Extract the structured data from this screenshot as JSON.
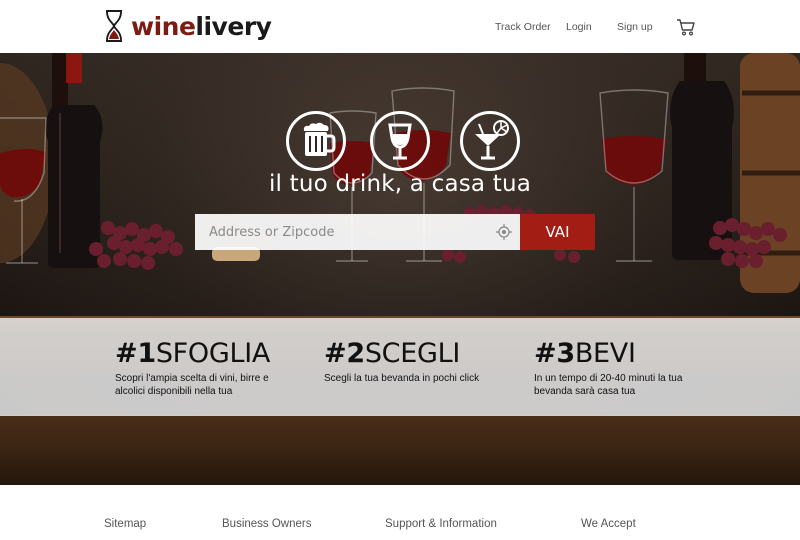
{
  "brand": {
    "name_part1": "wine",
    "name_part2": "livery",
    "accent": "#7d1a14"
  },
  "nav": {
    "track_order": "Track Order",
    "login": "Login",
    "sign_up": "Sign up",
    "cart_icon": "cart-icon"
  },
  "hero": {
    "icons": [
      "beer-mug-icon",
      "wine-glass-icon",
      "cocktail-icon"
    ],
    "tagline": "il tuo drink, a casa tua",
    "search": {
      "placeholder": "Address or Zipcode",
      "value": "",
      "button_label": "VAI",
      "button_color": "#a21d13",
      "locate_icon": "crosshair-icon"
    }
  },
  "steps": [
    {
      "number": "#1",
      "word": "SFOGLIA",
      "desc": "Scopri l'ampia scelta di vini, birre e alcolici disponibili nella tua"
    },
    {
      "number": "#2",
      "word": "SCEGLI",
      "desc": "Scegli la tua bevanda in pochi click"
    },
    {
      "number": "#3",
      "word": "BEVI",
      "desc": "In un tempo di 20-40 minuti la tua bevanda sarà casa tua"
    }
  ],
  "footer": {
    "sitemap": "Sitemap",
    "business": "Business Owners",
    "support": "Support & Information",
    "accept": "We Accept"
  }
}
